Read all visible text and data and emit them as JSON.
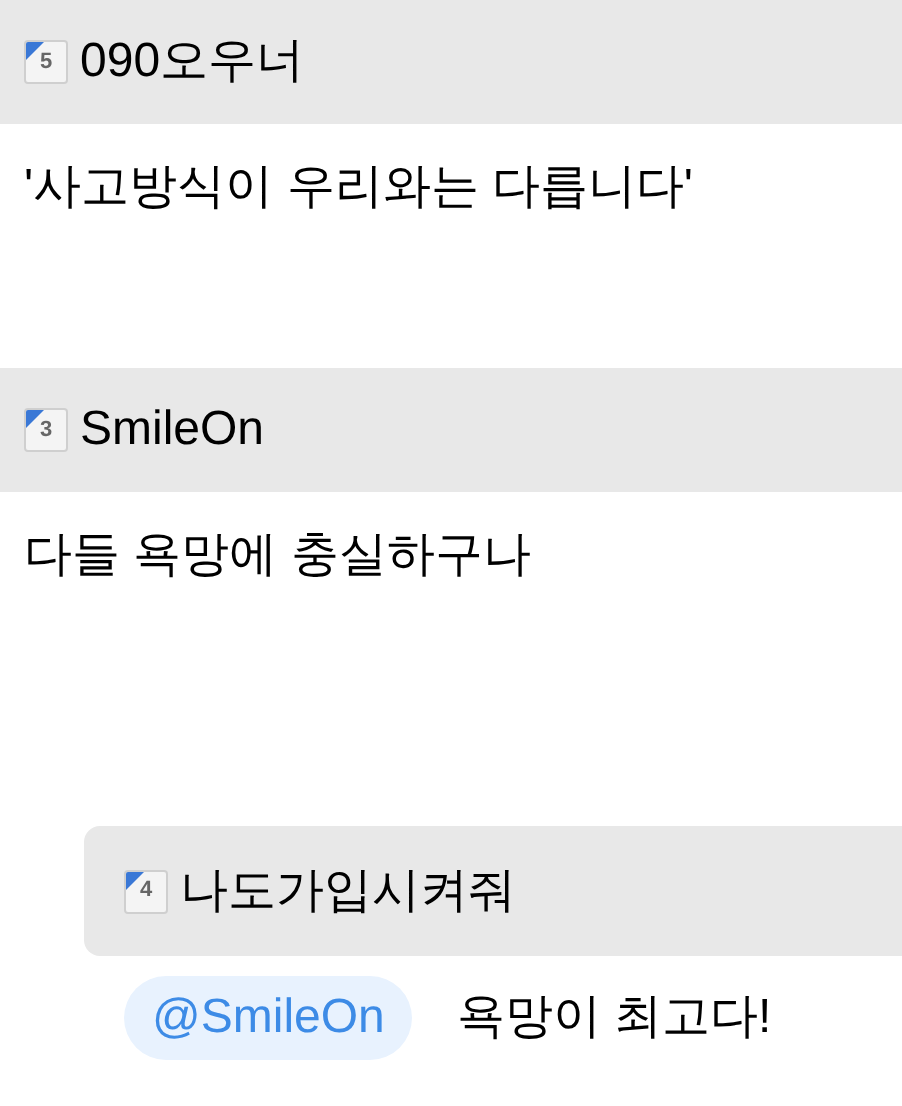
{
  "comments": [
    {
      "author": "090오우너",
      "badge": "5",
      "text": "'사고방식이 우리와는 다릅니다'"
    },
    {
      "author": "SmileOn",
      "badge": "3",
      "text": "다들 욕망에 충실하구나",
      "replies": [
        {
          "author": "나도가입시켜줘",
          "badge": "4",
          "mention": "@SmileOn",
          "text": "욕망이 최고다!"
        }
      ]
    }
  ]
}
